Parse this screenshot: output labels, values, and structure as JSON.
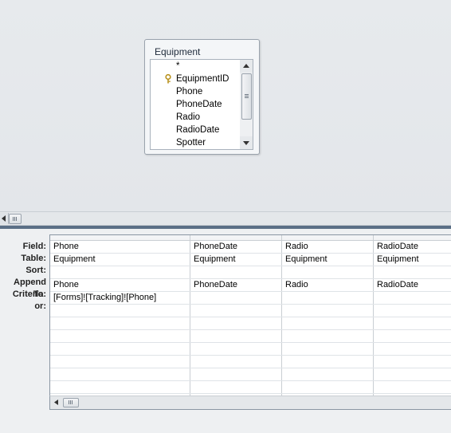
{
  "table": {
    "name": "Equipment",
    "fields": [
      "*",
      "EquipmentID",
      "Phone",
      "PhoneDate",
      "Radio",
      "RadioDate",
      "Spotter"
    ],
    "primary_key": "EquipmentID"
  },
  "grid": {
    "row_labels": [
      "Field:",
      "Table:",
      "Sort:",
      "Append To:",
      "Criteria:",
      "or:"
    ],
    "columns": [
      {
        "field": "Phone",
        "table": "Equipment",
        "sort": "",
        "append_to": "Phone",
        "criteria": "[Forms]![Tracking]![Phone]",
        "or": ""
      },
      {
        "field": "PhoneDate",
        "table": "Equipment",
        "sort": "",
        "append_to": "PhoneDate",
        "criteria": "",
        "or": ""
      },
      {
        "field": "Radio",
        "table": "Equipment",
        "sort": "",
        "append_to": "Radio",
        "criteria": "",
        "or": ""
      },
      {
        "field": "RadioDate",
        "table": "Equipment",
        "sort": "",
        "append_to": "RadioDate",
        "criteria": "",
        "or": ""
      }
    ],
    "empty_rows": 8
  },
  "colors": {
    "accent": "#5b6f86",
    "pane_background": "#e8ebee",
    "key_icon": "#c8a22a"
  },
  "icons": {
    "primary_key": "key-icon",
    "scroll_up": "arrow-up-icon",
    "scroll_down": "arrow-down-icon",
    "scroll_left": "arrow-left-icon"
  }
}
